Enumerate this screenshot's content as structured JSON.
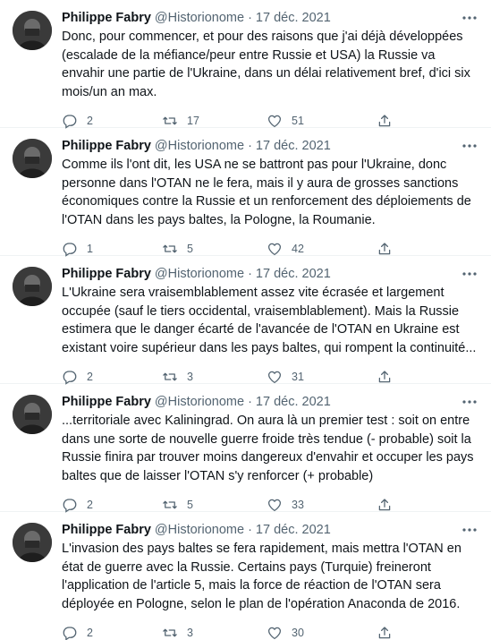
{
  "tweets": [
    {
      "name": "Philippe Fabry",
      "handle": "@Historionome",
      "separator": "·",
      "date": "17 déc. 2021",
      "text": "Donc, pour commencer, et pour des raisons que j'ai déjà développées (escalade de la méfiance/peur entre Russie et USA) la Russie va envahir une partie de l'Ukraine, dans un délai relativement bref, d'ici six mois/un an max.",
      "replies": "2",
      "retweets": "17",
      "likes": "51"
    },
    {
      "name": "Philippe Fabry",
      "handle": "@Historionome",
      "separator": "·",
      "date": "17 déc. 2021",
      "text": "Comme ils l'ont dit, les USA ne se battront pas pour l'Ukraine, donc personne dans l'OTAN ne le fera, mais il y aura de grosses sanctions économiques contre la Russie et un renforcement des déploiements de l'OTAN dans les pays baltes, la Pologne, la Roumanie.",
      "replies": "1",
      "retweets": "5",
      "likes": "42"
    },
    {
      "name": "Philippe Fabry",
      "handle": "@Historionome",
      "separator": "·",
      "date": "17 déc. 2021",
      "text": "L'Ukraine sera vraisemblablement assez vite écrasée et largement occupée (sauf le tiers occidental, vraisemblablement). Mais la Russie estimera que le danger écarté de l'avancée de l'OTAN en Ukraine est existant voire supérieur dans les pays baltes, qui rompent la continuité...",
      "replies": "2",
      "retweets": "3",
      "likes": "31"
    },
    {
      "name": "Philippe Fabry",
      "handle": "@Historionome",
      "separator": "·",
      "date": "17 déc. 2021",
      "text": "...territoriale avec Kaliningrad. On aura là un premier test : soit on entre dans une sorte de nouvelle guerre froide très tendue (- probable) soit la Russie finira par trouver moins dangereux d'envahir et occuper les pays baltes que de laisser l'OTAN s'y renforcer (+ probable)",
      "replies": "2",
      "retweets": "5",
      "likes": "33"
    },
    {
      "name": "Philippe Fabry",
      "handle": "@Historionome",
      "separator": "·",
      "date": "17 déc. 2021",
      "text": "L'invasion des pays baltes se fera rapidement, mais mettra l'OTAN en état de guerre avec la Russie. Certains pays (Turquie) freineront l'application de l'article 5, mais la force de réaction de l'OTAN sera déployée en Pologne, selon le plan de l'opération Anaconda de 2016.",
      "replies": "2",
      "retweets": "3",
      "likes": "30"
    }
  ],
  "icons": {
    "avatar": "avatar",
    "more": "more-horizontal-icon",
    "reply": "reply-bubble-icon",
    "retweet": "retweet-icon",
    "like": "heart-icon",
    "share": "share-upload-icon"
  },
  "colors": {
    "text": "#0f1419",
    "muted": "#536471",
    "border": "#eff3f4"
  }
}
